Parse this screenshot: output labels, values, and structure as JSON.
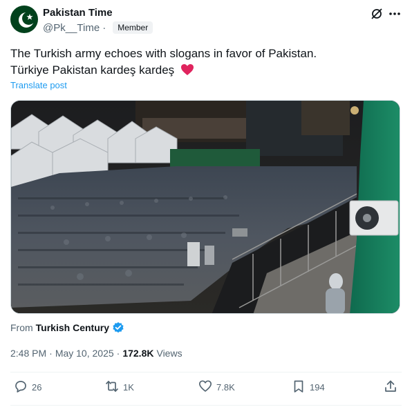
{
  "author": {
    "name": "Pakistan Time",
    "handle": "@Pk__Time",
    "separator": "·",
    "badge": "Member"
  },
  "post": {
    "line1": "The Turkish army echoes with slogans in favor of Pakistan.",
    "line2": "Türkiye Pakistan kardeş kardeş",
    "heart_emoji": "❤️",
    "translate_label": "Translate post"
  },
  "source": {
    "prefix": "From",
    "name": "Turkish Century"
  },
  "meta": {
    "time": "2:48 PM",
    "sep1": "·",
    "date": "May 10, 2025",
    "sep2": "·",
    "views_count": "172.8K",
    "views_label": "Views"
  },
  "actions": {
    "replies": "26",
    "reposts": "1K",
    "likes": "7.8K",
    "bookmarks": "194"
  },
  "icons": [
    "pakistan-flag-avatar",
    "grok-icon",
    "more-icon",
    "verified-icon",
    "reply-icon",
    "repost-icon",
    "like-icon",
    "bookmark-icon",
    "share-icon"
  ],
  "colors": {
    "accent": "#1d9bf0",
    "secondary_text": "#536471",
    "primary_text": "#0f1419",
    "heart": "#f91880",
    "flag_green": "#01411c"
  }
}
